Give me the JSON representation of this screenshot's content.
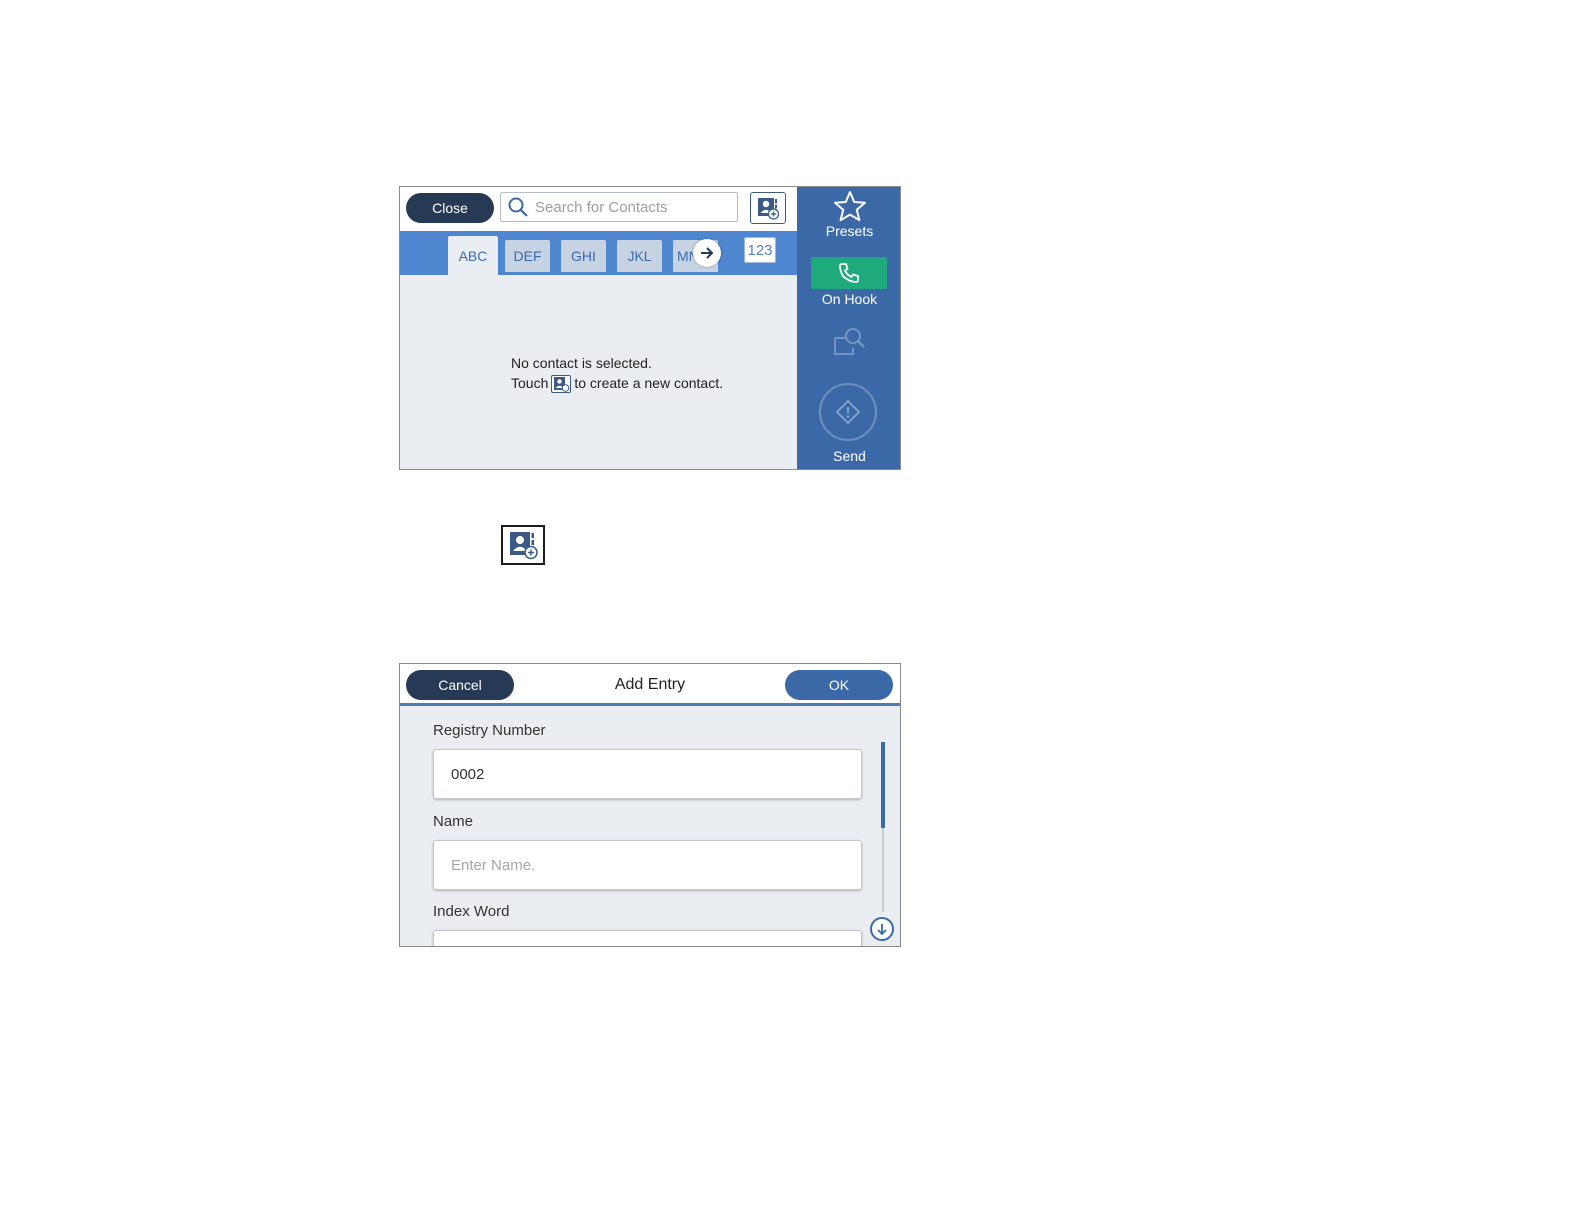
{
  "contacts_screen": {
    "close_label": "Close",
    "search_placeholder": "Search for Contacts",
    "tabs": [
      "ABC",
      "DEF",
      "GHI",
      "JKL",
      "MN"
    ],
    "numeric_tab": "123",
    "empty_line1": "No contact is selected.",
    "empty_touch": "Touch",
    "empty_suffix": "to create a new contact.",
    "sidebar": {
      "presets_label": "Presets",
      "onhook_label": "On Hook",
      "send_label": "Send"
    }
  },
  "add_entry_screen": {
    "cancel_label": "Cancel",
    "title": "Add Entry",
    "ok_label": "OK",
    "registry_label": "Registry Number",
    "registry_value": "0002",
    "name_label": "Name",
    "name_placeholder": "Enter Name.",
    "index_label": "Index Word"
  },
  "colors": {
    "dark_button": "#263a55",
    "accent_blue": "#3b68a6",
    "tab_bar": "#4e86cf",
    "onhook_green": "#1faa7d"
  }
}
